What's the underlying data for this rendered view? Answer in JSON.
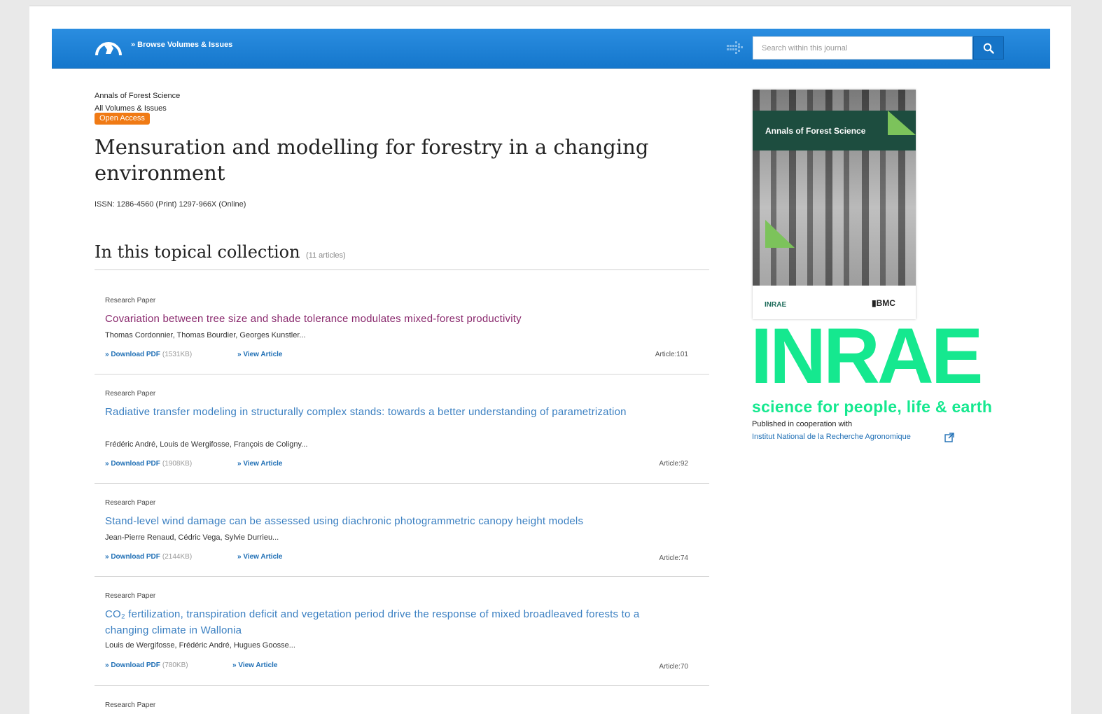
{
  "header": {
    "breadcrumb_link": "» Browse Volumes & Issues",
    "search_placeholder": "Search within this journal"
  },
  "crumbs": {
    "journal": "Annals of Forest Science",
    "all_volumes": "All Volumes & Issues",
    "badge": "Open Access"
  },
  "page": {
    "title": "Mensuration and modelling for forestry in a changing environment",
    "issn": "ISSN: 1286-4560 (Print) 1297-966X (Online)"
  },
  "collection": {
    "heading": "In this topical collection",
    "count": "(11 articles)"
  },
  "articles": [
    {
      "type": "Research Paper",
      "title": "Covariation between tree size and shade tolerance modulates mixed-forest productivity",
      "authors": "Thomas Cordonnier, Thomas Bourdier, Georges Kunstler...",
      "download": "» Download PDF",
      "size": "(1531KB)",
      "view": "» View Article",
      "number": "Article:101"
    },
    {
      "type": "Research Paper",
      "title": "Radiative transfer modeling in structurally complex stands: towards a better understanding of parametrization",
      "authors": "Frédéric André, Louis de Wergifosse, François de Coligny...",
      "download": "» Download PDF",
      "size": "(1908KB)",
      "view": "» View Article",
      "number": "Article:92"
    },
    {
      "type": "Research Paper",
      "title": "Stand-level wind damage can be assessed using diachronic photogrammetric canopy height models",
      "authors": "Jean-Pierre Renaud, Cédric Vega, Sylvie Durrieu...",
      "download": "» Download PDF",
      "size": "(2144KB)",
      "view": "» View Article",
      "number": "Article:74"
    },
    {
      "type": "Research Paper",
      "title": "CO₂ fertilization, transpiration deficit and vegetation period drive the response of mixed broadleaved forests to a changing climate in Wallonia",
      "authors": "Louis de Wergifosse, Frédéric André, Hugues Goosse...",
      "download": "» Download PDF",
      "size": "(780KB)",
      "view": "» View Article",
      "number": "Article:70"
    },
    {
      "type": "Research Paper"
    }
  ],
  "sidebar": {
    "cover_title": "Annals of Forest Science",
    "cover_publisher_left": "INRAE",
    "cover_publisher_right": "BMC",
    "logo_text": "INRAE",
    "tagline": "science for people, life & earth",
    "coop_text": "Published in cooperation with",
    "coop_link": "Institut National de la Recherche Agronomique"
  }
}
